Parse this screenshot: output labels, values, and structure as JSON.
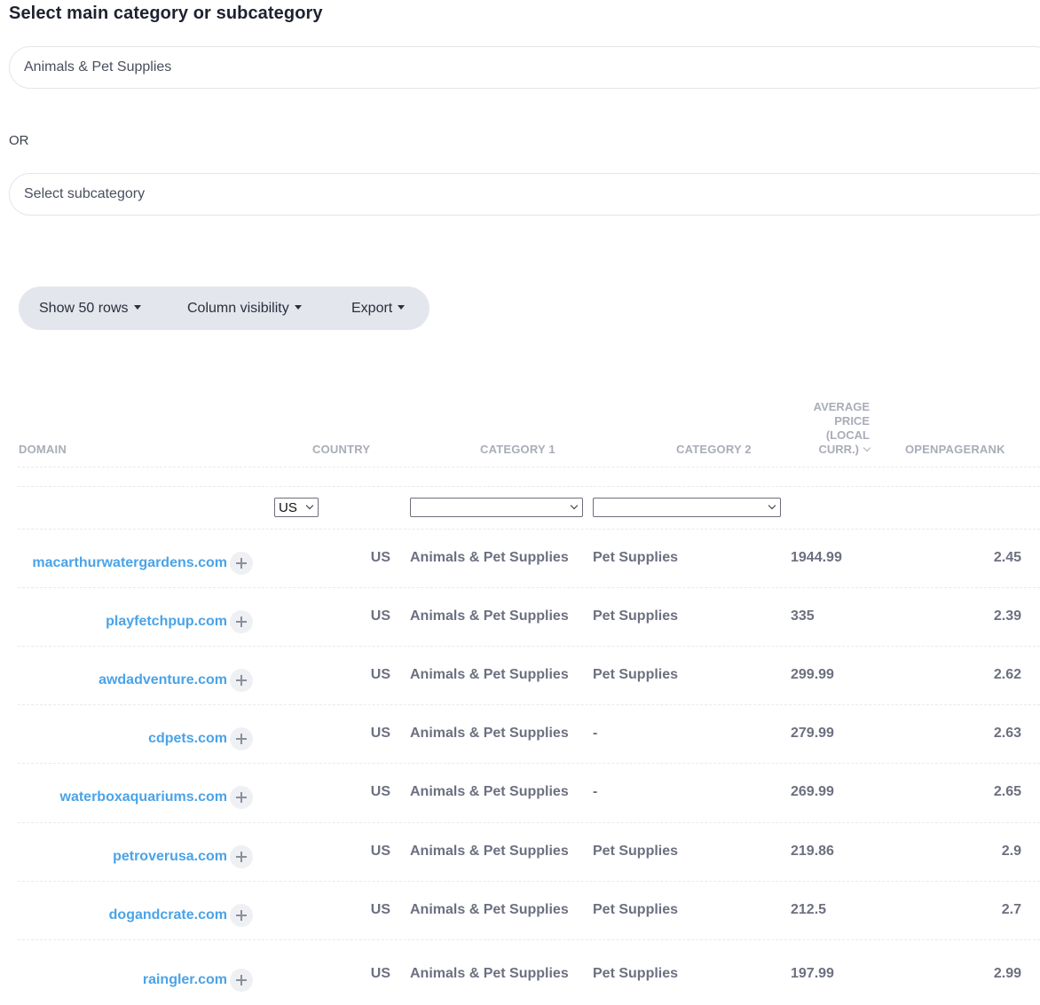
{
  "heading": "Select main category or subcategory",
  "main_category": {
    "value": "Animals & Pet Supplies"
  },
  "or_label": "OR",
  "subcategory": {
    "placeholder": "Select subcategory"
  },
  "toolbar": {
    "show_rows": "Show 50 rows",
    "column_visibility": "Column visibility",
    "export": "Export"
  },
  "columns": {
    "domain": "DOMAIN",
    "country": "COUNTRY",
    "category1": "CATEGORY 1",
    "category2": "CATEGORY 2",
    "avg_price_lines": [
      "AVERAGE",
      "PRICE",
      "(LOCAL",
      "CURR.)"
    ],
    "openpagerank": "OPENPAGERANK"
  },
  "filters": {
    "country": "US",
    "category1": "",
    "category2": ""
  },
  "rows": [
    {
      "domain": "macarthurwatergardens.com",
      "country": "US",
      "category1": "Animals & Pet Supplies",
      "category2": "Pet Supplies",
      "avg_price": "1944.99",
      "openpagerank": "2.45"
    },
    {
      "domain": "playfetchpup.com",
      "country": "US",
      "category1": "Animals & Pet Supplies",
      "category2": "Pet Supplies",
      "avg_price": "335",
      "openpagerank": "2.39"
    },
    {
      "domain": "awdadventure.com",
      "country": "US",
      "category1": "Animals & Pet Supplies",
      "category2": "Pet Supplies",
      "avg_price": "299.99",
      "openpagerank": "2.62"
    },
    {
      "domain": "cdpets.com",
      "country": "US",
      "category1": "Animals & Pet Supplies",
      "category2": "-",
      "avg_price": "279.99",
      "openpagerank": "2.63"
    },
    {
      "domain": "waterboxaquariums.com",
      "country": "US",
      "category1": "Animals & Pet Supplies",
      "category2": "-",
      "avg_price": "269.99",
      "openpagerank": "2.65"
    },
    {
      "domain": "petroverusa.com",
      "country": "US",
      "category1": "Animals & Pet Supplies",
      "category2": "Pet Supplies",
      "avg_price": "219.86",
      "openpagerank": "2.9"
    },
    {
      "domain": "dogandcrate.com",
      "country": "US",
      "category1": "Animals & Pet Supplies",
      "category2": "Pet Supplies",
      "avg_price": "212.5",
      "openpagerank": "2.7"
    },
    {
      "domain": "raingler.com",
      "country": "US",
      "category1": "Animals & Pet Supplies",
      "category2": "Pet Supplies",
      "avg_price": "197.99",
      "openpagerank": "2.99"
    }
  ]
}
